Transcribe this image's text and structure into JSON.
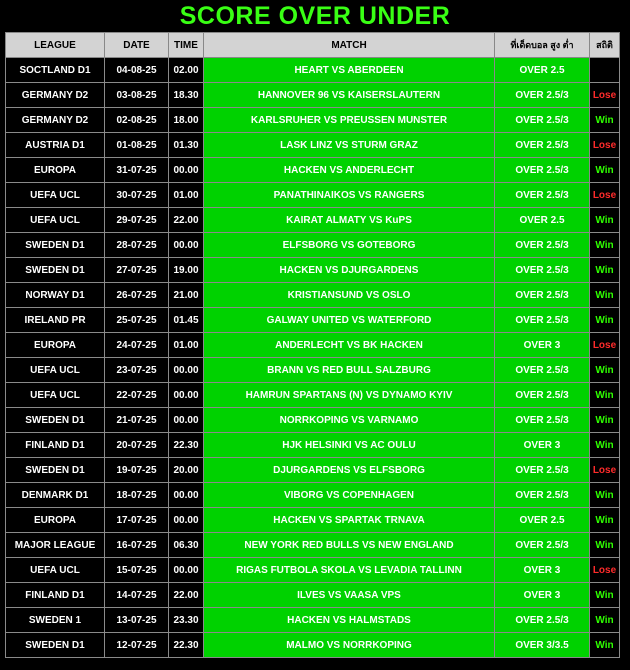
{
  "title": "SCORE OVER UNDER",
  "headers": {
    "league": "LEAGUE",
    "date": "DATE",
    "time": "TIME",
    "match": "MATCH",
    "pick": "ที่เด็ดบอล สูง ต่ำ",
    "stats": "สถิติ"
  },
  "colors": {
    "title": "#39ff14",
    "green_cell": "#00d200",
    "win": "#2fff00",
    "lose": "#ff2b2b"
  },
  "rows": [
    {
      "league": "SOCTLAND D1",
      "date": "04-08-25",
      "time": "02.00",
      "match": "HEART VS ABERDEEN",
      "pick": "OVER 2.5",
      "result": ""
    },
    {
      "league": "GERMANY D2",
      "date": "03-08-25",
      "time": "18.30",
      "match": "HANNOVER 96 VS KAISERSLAUTERN",
      "pick": "OVER 2.5/3",
      "result": "Lose"
    },
    {
      "league": "GERMANY D2",
      "date": "02-08-25",
      "time": "18.00",
      "match": "KARLSRUHER VS PREUSSEN MUNSTER",
      "pick": "OVER 2.5/3",
      "result": "Win"
    },
    {
      "league": "AUSTRIA D1",
      "date": "01-08-25",
      "time": "01.30",
      "match": "LASK LINZ VS STURM GRAZ",
      "pick": "OVER 2.5/3",
      "result": "Lose"
    },
    {
      "league": "EUROPA",
      "date": "31-07-25",
      "time": "00.00",
      "match": "HACKEN VS ANDERLECHT",
      "pick": "OVER 2.5/3",
      "result": "Win"
    },
    {
      "league": "UEFA UCL",
      "date": "30-07-25",
      "time": "01.00",
      "match": "PANATHINAIKOS VS RANGERS",
      "pick": "OVER 2.5/3",
      "result": "Lose"
    },
    {
      "league": "UEFA UCL",
      "date": "29-07-25",
      "time": "22.00",
      "match": "KAIRAT ALMATY VS KuPS",
      "pick": "OVER 2.5",
      "result": "Win"
    },
    {
      "league": "SWEDEN D1",
      "date": "28-07-25",
      "time": "00.00",
      "match": "ELFSBORG VS GOTEBORG",
      "pick": "OVER 2.5/3",
      "result": "Win"
    },
    {
      "league": "SWEDEN D1",
      "date": "27-07-25",
      "time": "19.00",
      "match": "HACKEN VS DJURGARDENS",
      "pick": "OVER 2.5/3",
      "result": "Win"
    },
    {
      "league": "NORWAY D1",
      "date": "26-07-25",
      "time": "21.00",
      "match": "KRISTIANSUND VS OSLO",
      "pick": "OVER 2.5/3",
      "result": "Win"
    },
    {
      "league": "IRELAND PR",
      "date": "25-07-25",
      "time": "01.45",
      "match": "GALWAY UNITED VS WATERFORD",
      "pick": "OVER 2.5/3",
      "result": "Win"
    },
    {
      "league": "EUROPA",
      "date": "24-07-25",
      "time": "01.00",
      "match": "ANDERLECHT VS BK HACKEN",
      "pick": "OVER 3",
      "result": "Lose"
    },
    {
      "league": "UEFA UCL",
      "date": "23-07-25",
      "time": "00.00",
      "match": "BRANN VS RED BULL SALZBURG",
      "pick": "OVER 2.5/3",
      "result": "Win"
    },
    {
      "league": "UEFA UCL",
      "date": "22-07-25",
      "time": "00.00",
      "match": "HAMRUN SPARTANS (N) VS DYNAMO KYIV",
      "pick": "OVER 2.5/3",
      "result": "Win"
    },
    {
      "league": "SWEDEN D1",
      "date": "21-07-25",
      "time": "00.00",
      "match": "NORRKOPING VS VARNAMO",
      "pick": "OVER 2.5/3",
      "result": "Win"
    },
    {
      "league": "FINLAND D1",
      "date": "20-07-25",
      "time": "22.30",
      "match": "HJK HELSINKI VS AC OULU",
      "pick": "OVER 3",
      "result": "Win"
    },
    {
      "league": "SWEDEN D1",
      "date": "19-07-25",
      "time": "20.00",
      "match": "DJURGARDENS VS ELFSBORG",
      "pick": "OVER 2.5/3",
      "result": "Lose"
    },
    {
      "league": "DENMARK D1",
      "date": "18-07-25",
      "time": "00.00",
      "match": "VIBORG VS COPENHAGEN",
      "pick": "OVER 2.5/3",
      "result": "Win"
    },
    {
      "league": "EUROPA",
      "date": "17-07-25",
      "time": "00.00",
      "match": "HACKEN VS SPARTAK TRNAVA",
      "pick": "OVER 2.5",
      "result": "Win"
    },
    {
      "league": "MAJOR LEAGUE",
      "date": "16-07-25",
      "time": "06.30",
      "match": "NEW YORK RED BULLS VS NEW ENGLAND",
      "pick": "OVER 2.5/3",
      "result": "Win"
    },
    {
      "league": "UEFA UCL",
      "date": "15-07-25",
      "time": "00.00",
      "match": "RIGAS FUTBOLA SKOLA VS LEVADIA TALLINN",
      "pick": "OVER 3",
      "result": "Lose"
    },
    {
      "league": "FINLAND D1",
      "date": "14-07-25",
      "time": "22.00",
      "match": "ILVES  VS VAASA VPS",
      "pick": "OVER 3",
      "result": "Win"
    },
    {
      "league": "SWEDEN 1",
      "date": "13-07-25",
      "time": "23.30",
      "match": "HACKEN VS HALMSTADS",
      "pick": "OVER 2.5/3",
      "result": "Win"
    },
    {
      "league": "SWEDEN D1",
      "date": "12-07-25",
      "time": "22.30",
      "match": "MALMO VS NORRKOPING",
      "pick": "OVER 3/3.5",
      "result": "Win"
    }
  ]
}
